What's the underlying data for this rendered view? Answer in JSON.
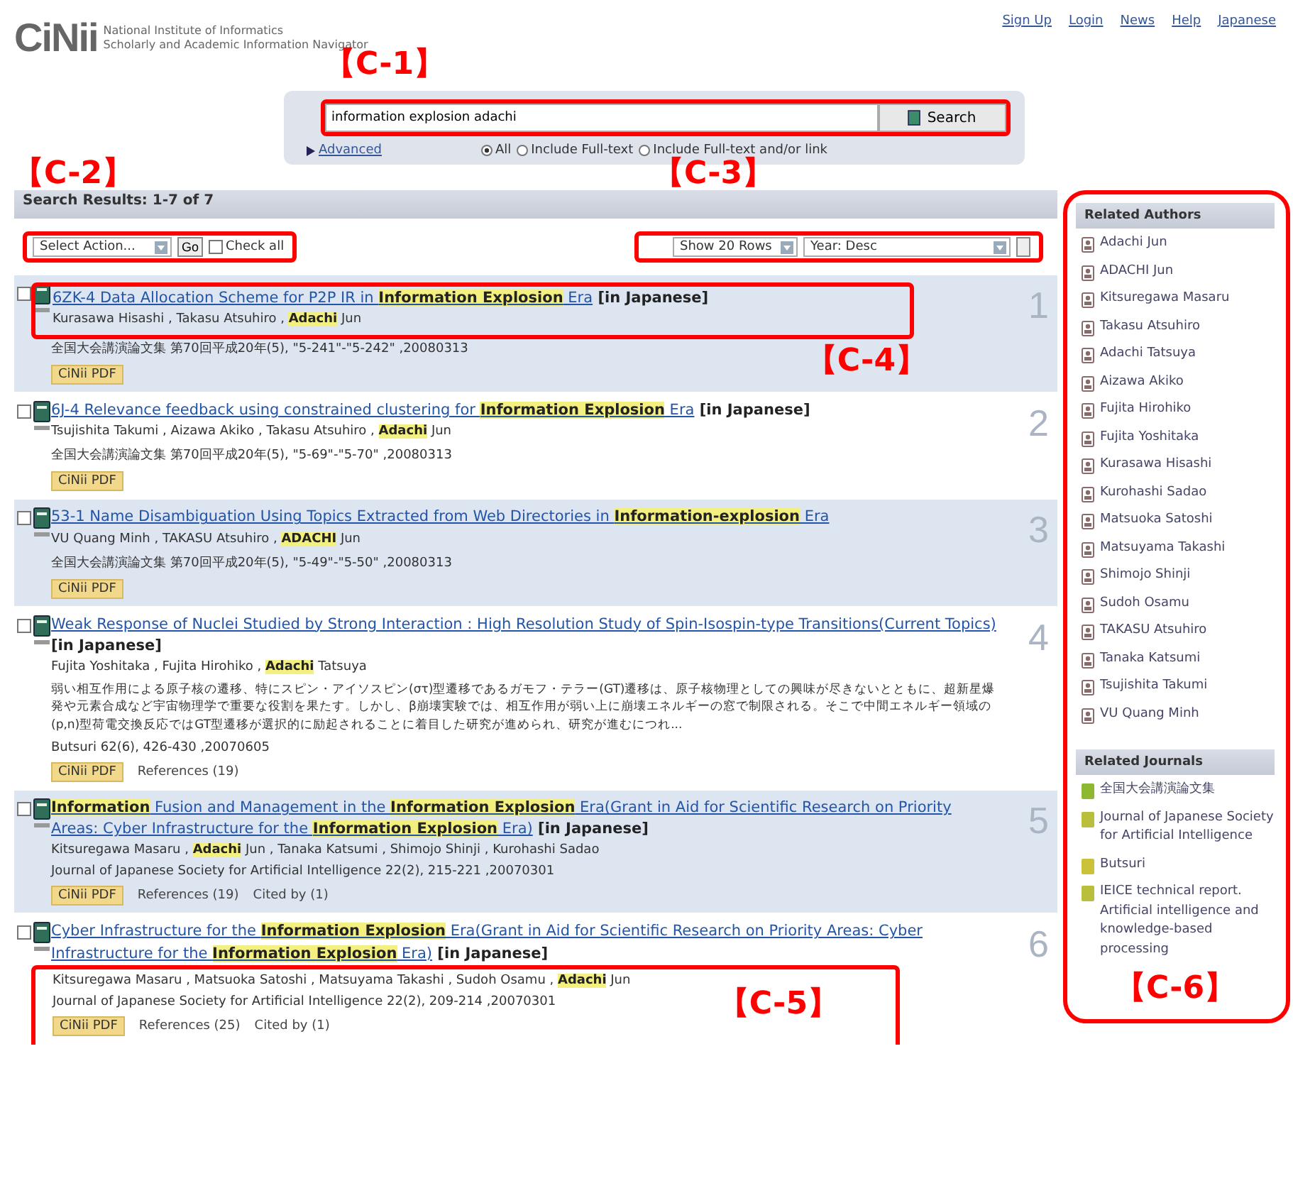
{
  "header": {
    "logo": "CiNii",
    "logo_lines": [
      "National Institute of Informatics",
      "Scholarly and Academic Information Navigator"
    ],
    "links": [
      "Sign Up",
      "Login",
      "News",
      "Help",
      "Japanese"
    ]
  },
  "search": {
    "annotation": "【C-1】",
    "value": "information explosion adachi",
    "button": "Search",
    "advanced": "Advanced",
    "options": [
      {
        "label": "All",
        "selected": true
      },
      {
        "label": "Include Full-text",
        "selected": false
      },
      {
        "label": "Include Full-text and/or link",
        "selected": false
      }
    ]
  },
  "results_bar": {
    "title": "Search Results: 1-7 of 7"
  },
  "toolbar_left": {
    "annotation": "【C-2】",
    "action": "Select Action...",
    "go": "Go",
    "check_all": {
      "label": "Check all",
      "checked": false
    }
  },
  "toolbar_right": {
    "annotation": "【C-3】",
    "rows": "Show 20 Rows",
    "order": "Year: Desc"
  },
  "results": [
    {
      "number": "1",
      "checked": false,
      "annotation": "【C-4】",
      "title": "6ZK-4 Data Allocation Scheme for P2P IR in **Information Explosion** Era",
      "language": "[in Japanese]",
      "authors": "Kurasawa Hisashi , Takasu Atsuhiro , **Adachi** Jun",
      "source": "全国大会講演論文集 第70回平成20年(5), \"5-241\"-\"5-242\" ,20080313",
      "pdf": "CiNii PDF"
    },
    {
      "number": "2",
      "checked": false,
      "title": "6J-4 Relevance feedback using constrained clustering for **Information Explosion** Era",
      "language": "[in Japanese]",
      "authors": "Tsujishita Takumi , Aizawa Akiko , Takasu Atsuhiro , **Adachi** Jun",
      "source": "全国大会講演論文集 第70回平成20年(5), \"5-69\"-\"5-70\" ,20080313",
      "pdf": "CiNii PDF"
    },
    {
      "number": "3",
      "checked": false,
      "title": "53-1 Name Disambiguation Using Topics Extracted from Web Directories in **Information-explosion** Era",
      "authors": "VU Quang Minh , TAKASU Atsuhiro , **ADACHI** Jun",
      "source": "全国大会講演論文集 第70回平成20年(5), \"5-49\"-\"5-50\" ,20080313",
      "pdf": "CiNii PDF"
    },
    {
      "number": "4",
      "checked": false,
      "title": "Weak Response of Nuclei Studied by Strong Interaction : High Resolution Study of Spin-Isospin-type Transitions(Current Topics)",
      "language": "[in Japanese]",
      "authors": "Fujita Yoshitaka , Fujita Hirohiko , **Adachi** Tatsuya",
      "abstract": "弱い相互作用による原子核の遷移、特にスピン・アイソスピン(στ)型遷移であるガモフ・テラー(GT)遷移は、原子核物理としての興味が尽きないとともに、超新星爆発や元素合成など宇宙物理学で重要な役割を果たす。しかし、β崩壊実験では、相互作用が弱い上に崩壊エネルギーの窓で制限される。そこで中間エネルギー領域の(p,n)型荷電交換反応ではGT型遷移が選択的に励起されることに着目した研究が進められ、研究が進むにつれ...",
      "source": "Butsuri 62(6), 426-430 ,20070605",
      "pdf": "CiNii PDF",
      "links": [
        "References (19)"
      ]
    },
    {
      "number": "5",
      "checked": false,
      "title": "**Information** Fusion and Management in the **Information Explosion** Era(Grant in Aid for Scientific Research on Priority Areas: Cyber Infrastructure for the **Information Explosion** Era)",
      "language": "[in Japanese]",
      "authors": "Kitsuregawa Masaru , **Adachi** Jun , Tanaka Katsumi , Shimojo Shinji , Kurohashi Sadao",
      "source": "Journal of Japanese Society for Artificial Intelligence 22(2), 215-221 ,20070301",
      "pdf": "CiNii PDF",
      "links": [
        "References (19)",
        "Cited by (1)"
      ]
    },
    {
      "number": "6",
      "checked": false,
      "annotation": "【C-5】",
      "title": "Cyber Infrastructure for the **Information Explosion** Era(Grant in Aid for Scientific Research on Priority Areas: Cyber Infrastructure for the **Information Explosion** Era)",
      "language": "[in Japanese]",
      "authors": "Kitsuregawa Masaru , Matsuoka Satoshi , Matsuyama Takashi , Sudoh Osamu , **Adachi** Jun",
      "source": "Journal of Japanese Society for Artificial Intelligence 22(2), 209-214 ,20070301",
      "pdf": "CiNii PDF",
      "links": [
        "References (25)",
        "Cited by (1)"
      ]
    }
  ],
  "sidebar": {
    "annotation": "【C-6】",
    "authors_title": "Related Authors",
    "authors": [
      "Adachi Jun",
      "ADACHI Jun",
      "Kitsuregawa Masaru",
      "Takasu Atsuhiro",
      "Adachi Tatsuya",
      "Aizawa Akiko",
      "Fujita Hirohiko",
      "Fujita Yoshitaka",
      "Kurasawa Hisashi",
      "Kurohashi Sadao",
      "Matsuoka Satoshi",
      "Matsuyama Takashi",
      "Shimojo Shinji",
      "Sudoh Osamu",
      "TAKASU Atsuhiro",
      "Tanaka Katsumi",
      "Tsujishita Takumi",
      "VU Quang Minh"
    ],
    "journals_title": "Related Journals",
    "journals": [
      {
        "name": "全国大会講演論文集",
        "color": "#8fb832"
      },
      {
        "name": "Journal of Japanese Society for Artificial Intelligence",
        "color": "#b9bf3c"
      },
      {
        "name": "Butsuri",
        "color": "#c9c23a"
      },
      {
        "name": "IEICE technical report. Artificial intelligence and knowledge-based processing",
        "color": "#b9bf3c"
      }
    ]
  }
}
